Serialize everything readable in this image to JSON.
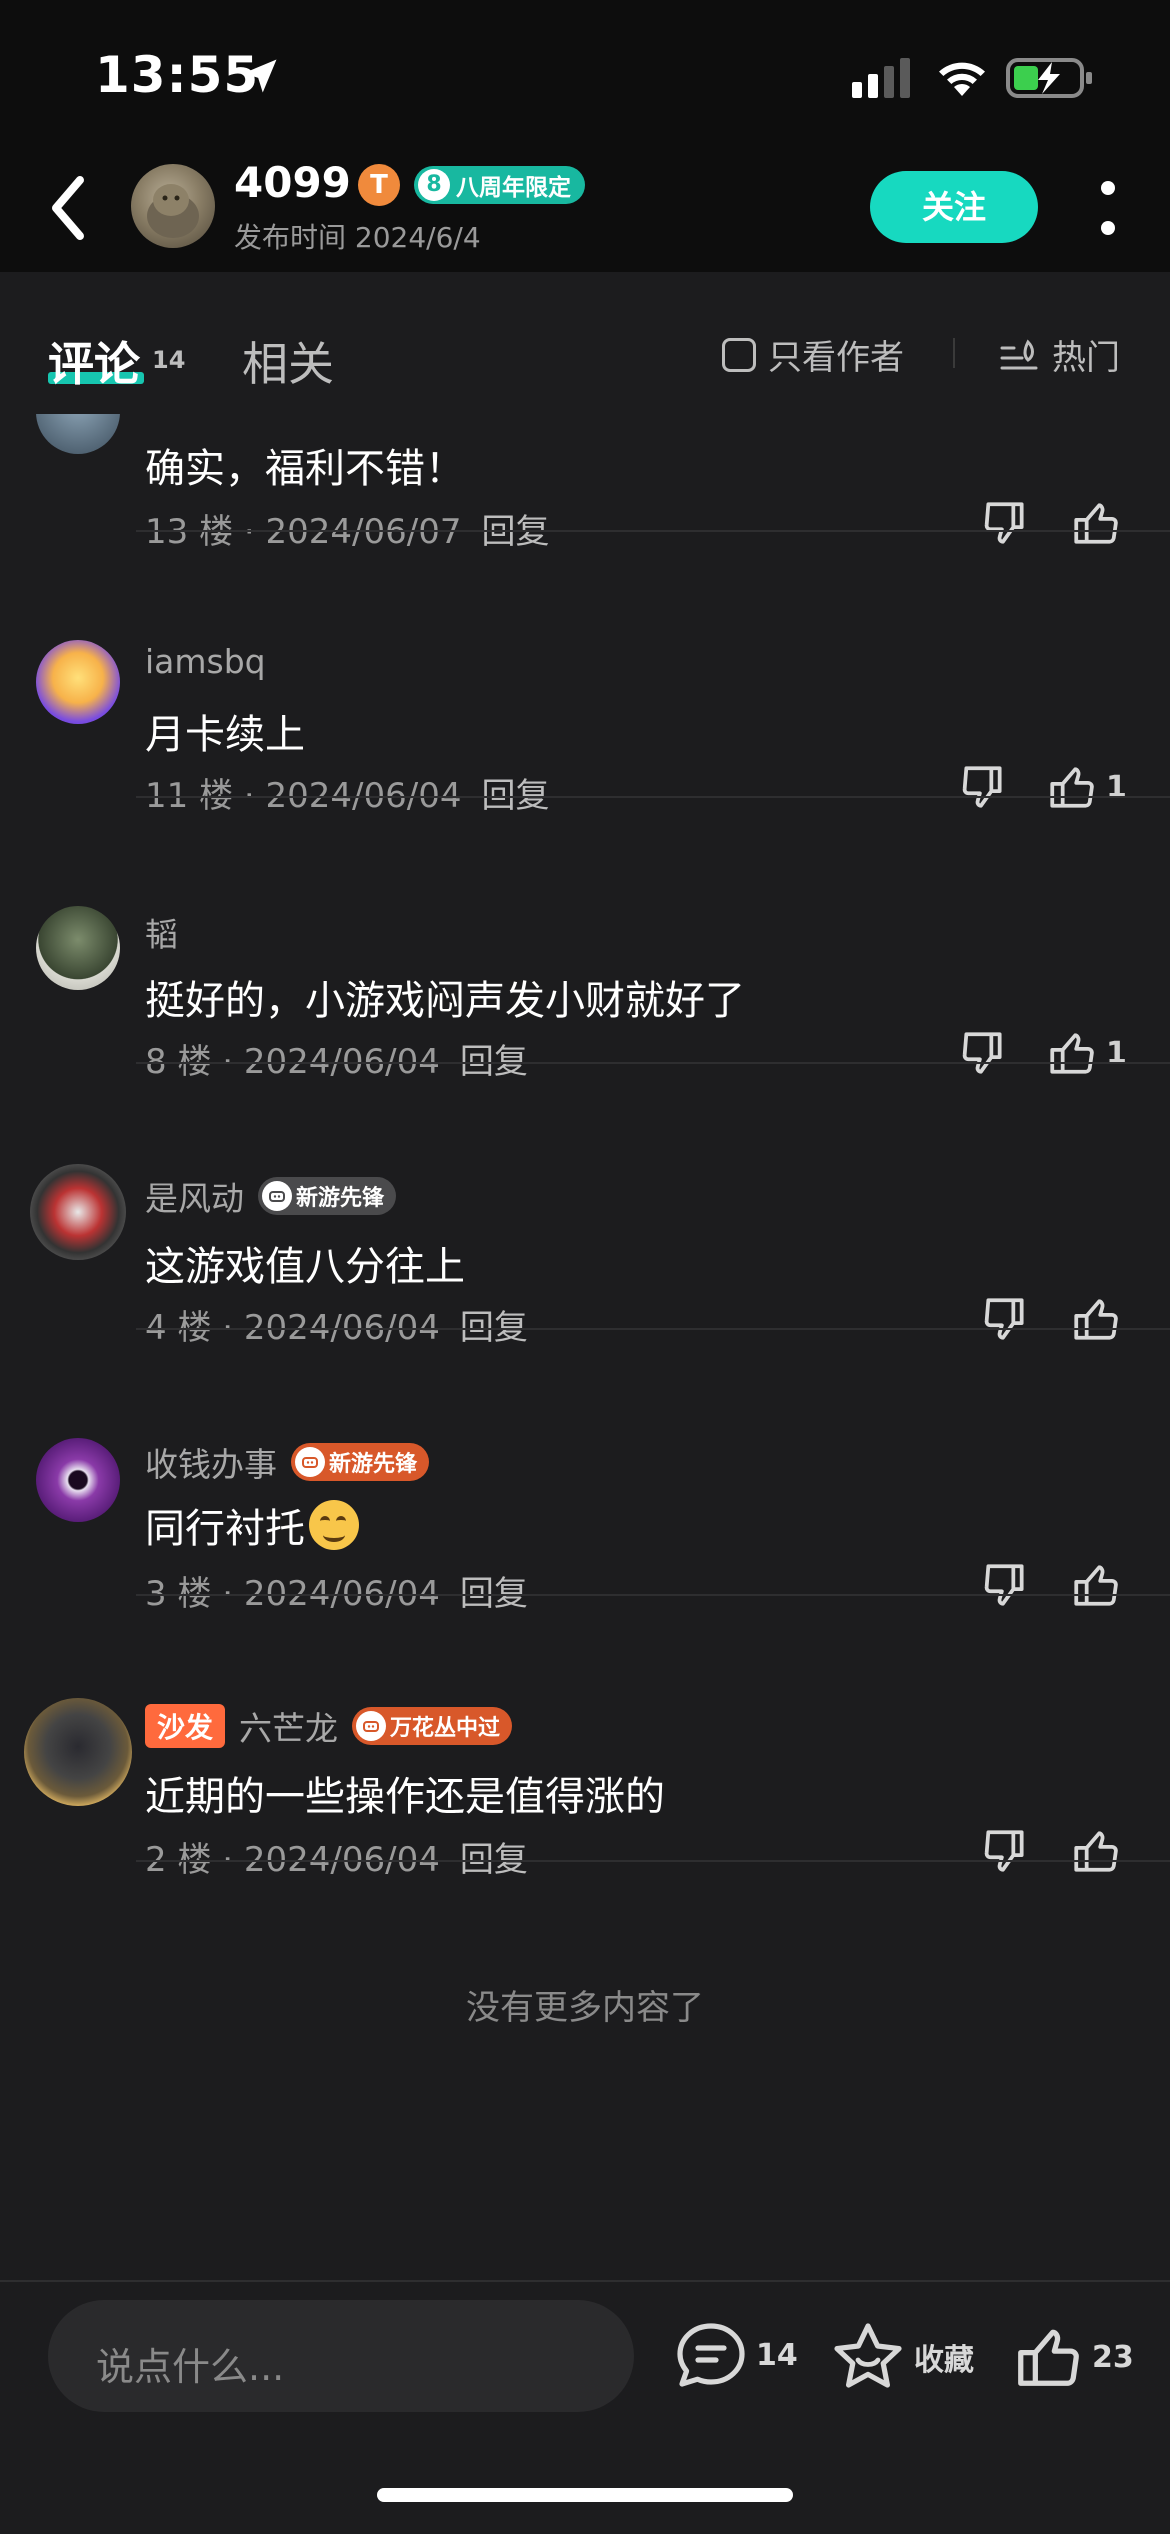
{
  "status_bar": {
    "time": "13:55"
  },
  "header": {
    "username": "4099",
    "level_badge": "T",
    "event_badge_num": "8",
    "event_badge_text": "八周年限定",
    "publish_time": "发布时间 2024/6/4",
    "follow_label": "关注"
  },
  "tabs": {
    "comments_label": "评论",
    "comments_count": "14",
    "related_label": "相关",
    "author_only_label": "只看作者",
    "sort_label": "热门"
  },
  "comments": [
    {
      "name": "",
      "text": "确实，福利不错！",
      "floor": "13 楼",
      "date": "2024/06/07",
      "reply": "回复",
      "likes": ""
    },
    {
      "name": "iamsbq",
      "text": "月卡续上",
      "floor": "11 楼",
      "date": "2024/06/04",
      "reply": "回复",
      "likes": "1"
    },
    {
      "name": "韬",
      "text": "挺好的，小游戏闷声发小财就好了",
      "floor": "8 楼",
      "date": "2024/06/04",
      "reply": "回复",
      "likes": "1"
    },
    {
      "name": "是风动",
      "medal": "新游先锋",
      "text": "这游戏值八分往上",
      "floor": "4 楼",
      "date": "2024/06/04",
      "reply": "回复",
      "likes": ""
    },
    {
      "name": "收钱办事",
      "medal": "新游先锋",
      "text": "同行衬托",
      "floor": "3 楼",
      "date": "2024/06/04",
      "reply": "回复",
      "likes": ""
    },
    {
      "sofa": "沙发",
      "name": "六芒龙",
      "medal": "万花丛中过",
      "text": "近期的一些操作还是值得涨的",
      "floor": "2 楼",
      "date": "2024/06/04",
      "reply": "回复",
      "likes": ""
    }
  ],
  "no_more": "没有更多内容了",
  "bottom_bar": {
    "input_placeholder": "说点什么...",
    "comment_count": "14",
    "favorite_label": "收藏",
    "like_count": "23"
  },
  "colors": {
    "accent": "#17d9c0",
    "background": "#1c1c1e",
    "header": "#0d0d0d",
    "sofa": "#ff6a3d"
  }
}
